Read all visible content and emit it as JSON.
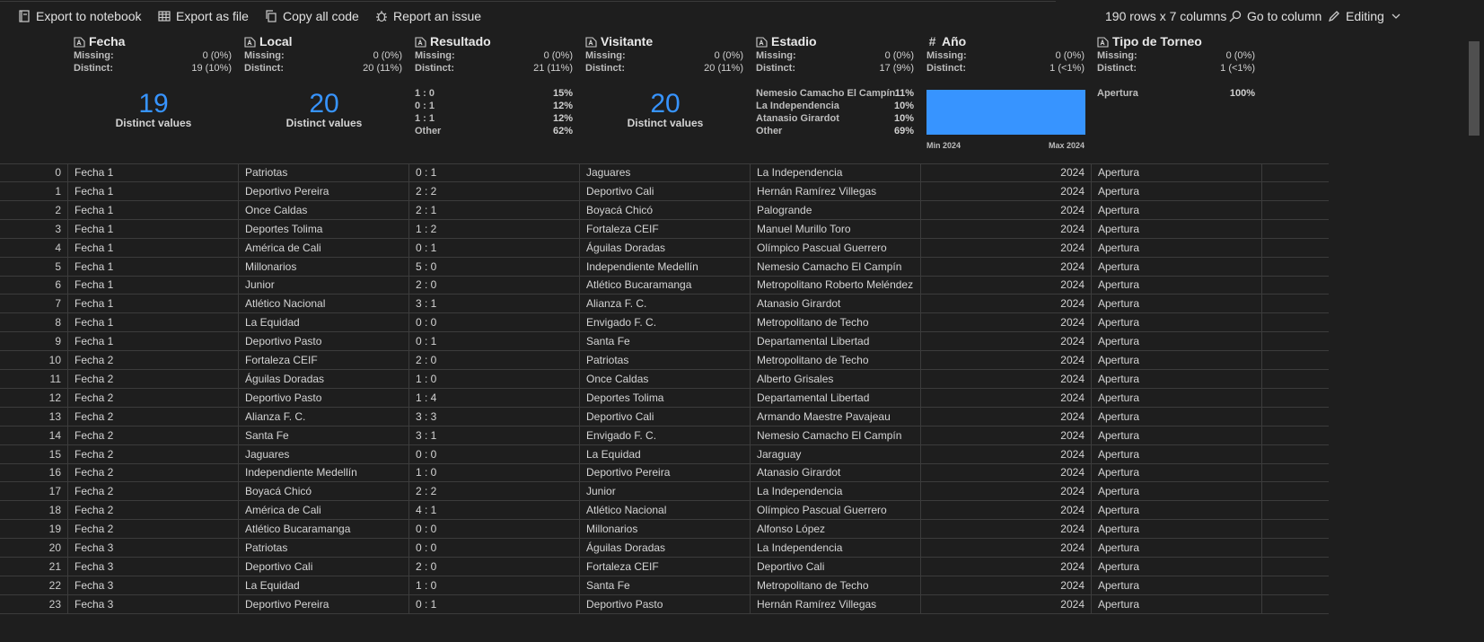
{
  "toolbar": {
    "export_notebook": "Export to notebook",
    "export_file": "Export as file",
    "copy_code": "Copy all code",
    "report_issue": "Report an issue",
    "shape": "190 rows x 7 columns",
    "go_to_column": "Go to column",
    "editing": "Editing"
  },
  "summary": {
    "missing_label": "Missing:",
    "distinct_label": "Distinct:",
    "distinct_values_label": "Distinct values",
    "fecha": {
      "title": "Fecha",
      "missing": "0 (0%)",
      "distinct": "19 (10%)",
      "big": "19"
    },
    "local": {
      "title": "Local",
      "missing": "0 (0%)",
      "distinct": "20 (11%)",
      "big": "20"
    },
    "resultado": {
      "title": "Resultado",
      "missing": "0 (0%)",
      "distinct": "21 (11%)",
      "freq": [
        {
          "v": "1 : 0",
          "p": "15%"
        },
        {
          "v": "0 : 1",
          "p": "12%"
        },
        {
          "v": "1 : 1",
          "p": "12%"
        },
        {
          "v": "Other",
          "p": "62%"
        }
      ]
    },
    "visitante": {
      "title": "Visitante",
      "missing": "0 (0%)",
      "distinct": "20 (11%)",
      "big": "20"
    },
    "estadio": {
      "title": "Estadio",
      "missing": "0 (0%)",
      "distinct": "17 (9%)",
      "freq": [
        {
          "v": "Nemesio Camacho El Campín",
          "p": "11%"
        },
        {
          "v": "La Independencia",
          "p": "10%"
        },
        {
          "v": "Atanasio Girardot",
          "p": "10%"
        },
        {
          "v": "Other",
          "p": "69%"
        }
      ]
    },
    "anio": {
      "title": "Año",
      "missing": "0 (0%)",
      "distinct": "1 (<1%)",
      "min": "Min 2024",
      "max": "Max 2024"
    },
    "tipo": {
      "title": "Tipo de Torneo",
      "missing": "0 (0%)",
      "distinct": "1 (<1%)",
      "freq": [
        {
          "v": "Apertura",
          "p": "100%"
        }
      ]
    }
  },
  "rows": [
    [
      "0",
      "Fecha 1",
      "Patriotas",
      "0 : 1",
      "Jaguares",
      "La Independencia",
      "2024",
      "Apertura"
    ],
    [
      "1",
      "Fecha 1",
      "Deportivo Pereira",
      "2 : 2",
      "Deportivo Cali",
      "Hernán Ramírez Villegas",
      "2024",
      "Apertura"
    ],
    [
      "2",
      "Fecha 1",
      "Once Caldas",
      "2 : 1",
      "Boyacá Chicó",
      "Palogrande",
      "2024",
      "Apertura"
    ],
    [
      "3",
      "Fecha 1",
      "Deportes Tolima",
      "1 : 2",
      "Fortaleza CEIF",
      "Manuel Murillo Toro",
      "2024",
      "Apertura"
    ],
    [
      "4",
      "Fecha 1",
      "América de Cali",
      "0 : 1",
      "Águilas Doradas",
      "Olímpico Pascual Guerrero",
      "2024",
      "Apertura"
    ],
    [
      "5",
      "Fecha 1",
      "Millonarios",
      "5 : 0",
      "Independiente Medellín",
      "Nemesio Camacho El Campín",
      "2024",
      "Apertura"
    ],
    [
      "6",
      "Fecha 1",
      "Junior",
      "2 : 0",
      "Atlético Bucaramanga",
      "Metropolitano Roberto Meléndez",
      "2024",
      "Apertura"
    ],
    [
      "7",
      "Fecha 1",
      "Atlético Nacional",
      "3 : 1",
      "Alianza F. C.",
      "Atanasio Girardot",
      "2024",
      "Apertura"
    ],
    [
      "8",
      "Fecha 1",
      "La Equidad",
      "0 : 0",
      "Envigado F. C.",
      "Metropolitano de Techo",
      "2024",
      "Apertura"
    ],
    [
      "9",
      "Fecha 1",
      "Deportivo Pasto",
      "0 : 1",
      "Santa Fe",
      "Departamental Libertad",
      "2024",
      "Apertura"
    ],
    [
      "10",
      "Fecha 2",
      "Fortaleza CEIF",
      "2 : 0",
      "Patriotas",
      "Metropolitano de Techo",
      "2024",
      "Apertura"
    ],
    [
      "11",
      "Fecha 2",
      "Águilas Doradas",
      "1 : 0",
      "Once Caldas",
      "Alberto Grisales",
      "2024",
      "Apertura"
    ],
    [
      "12",
      "Fecha 2",
      "Deportivo Pasto",
      "1 : 4",
      "Deportes Tolima",
      "Departamental Libertad",
      "2024",
      "Apertura"
    ],
    [
      "13",
      "Fecha 2",
      "Alianza F. C.",
      "3 : 3",
      "Deportivo Cali",
      "Armando Maestre Pavajeau",
      "2024",
      "Apertura"
    ],
    [
      "14",
      "Fecha 2",
      "Santa Fe",
      "3 : 1",
      "Envigado F. C.",
      "Nemesio Camacho El Campín",
      "2024",
      "Apertura"
    ],
    [
      "15",
      "Fecha 2",
      "Jaguares",
      "0 : 0",
      "La Equidad",
      "Jaraguay",
      "2024",
      "Apertura"
    ],
    [
      "16",
      "Fecha 2",
      "Independiente Medellín",
      "1 : 0",
      "Deportivo Pereira",
      "Atanasio Girardot",
      "2024",
      "Apertura"
    ],
    [
      "17",
      "Fecha 2",
      "Boyacá Chicó",
      "2 : 2",
      "Junior",
      "La Independencia",
      "2024",
      "Apertura"
    ],
    [
      "18",
      "Fecha 2",
      "América de Cali",
      "4 : 1",
      "Atlético Nacional",
      "Olímpico Pascual Guerrero",
      "2024",
      "Apertura"
    ],
    [
      "19",
      "Fecha 2",
      "Atlético Bucaramanga",
      "0 : 0",
      "Millonarios",
      "Alfonso López",
      "2024",
      "Apertura"
    ],
    [
      "20",
      "Fecha 3",
      "Patriotas",
      "0 : 0",
      "Águilas Doradas",
      "La Independencia",
      "2024",
      "Apertura"
    ],
    [
      "21",
      "Fecha 3",
      "Deportivo Cali",
      "2 : 0",
      "Fortaleza CEIF",
      "Deportivo Cali",
      "2024",
      "Apertura"
    ],
    [
      "22",
      "Fecha 3",
      "La Equidad",
      "1 : 0",
      "Santa Fe",
      "Metropolitano de Techo",
      "2024",
      "Apertura"
    ],
    [
      "23",
      "Fecha 3",
      "Deportivo Pereira",
      "0 : 1",
      "Deportivo Pasto",
      "Hernán Ramírez Villegas",
      "2024",
      "Apertura"
    ]
  ]
}
